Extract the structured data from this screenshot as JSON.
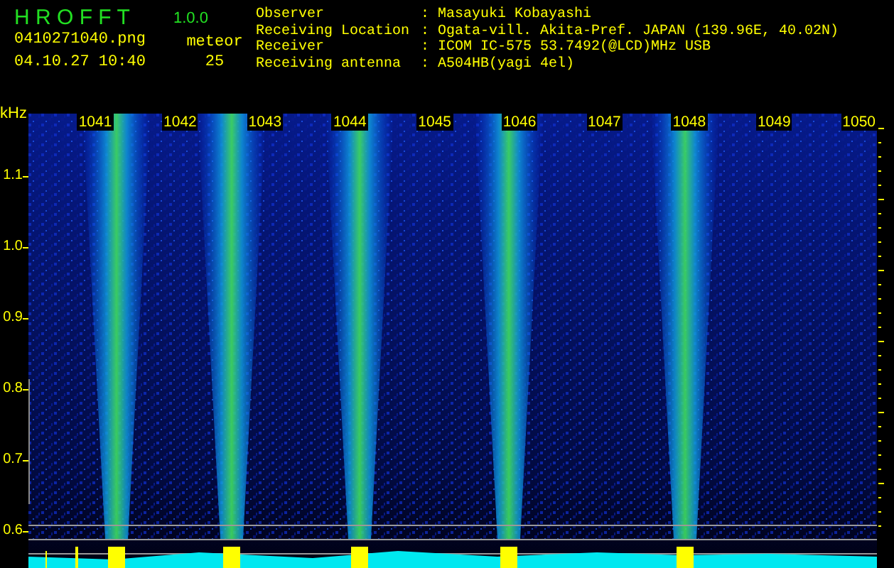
{
  "app": {
    "title": "H R O F F T",
    "version": "1.0.0"
  },
  "file": {
    "name": "0410271040.png",
    "datetime": "04.10.27 10:40"
  },
  "meteor": {
    "label": "meteor",
    "count": "25"
  },
  "info": [
    {
      "label": "Observer",
      "separator": ":",
      "value": "Masayuki Kobayashi"
    },
    {
      "label": "Receiving Location",
      "separator": ":",
      "value": "Ogata-vill. Akita-Pref. JAPAN (139.96E, 40.02N)"
    },
    {
      "label": "Receiver",
      "separator": ":",
      "value": "ICOM IC-575 53.7492(@LCD)MHz USB"
    },
    {
      "label": "Receiving antenna",
      "separator": ":",
      "value": "A504HB(yagi 4el)"
    }
  ],
  "spectrogram": {
    "y_unit": "kHz",
    "y_labels": [
      "1.1",
      "1.0",
      "0.9",
      "0.8",
      "0.7",
      "0.6"
    ],
    "time_labels": [
      "1041",
      "1042",
      "1043",
      "1044",
      "1045",
      "1046",
      "1047",
      "1048",
      "1049",
      "1050"
    ]
  }
}
